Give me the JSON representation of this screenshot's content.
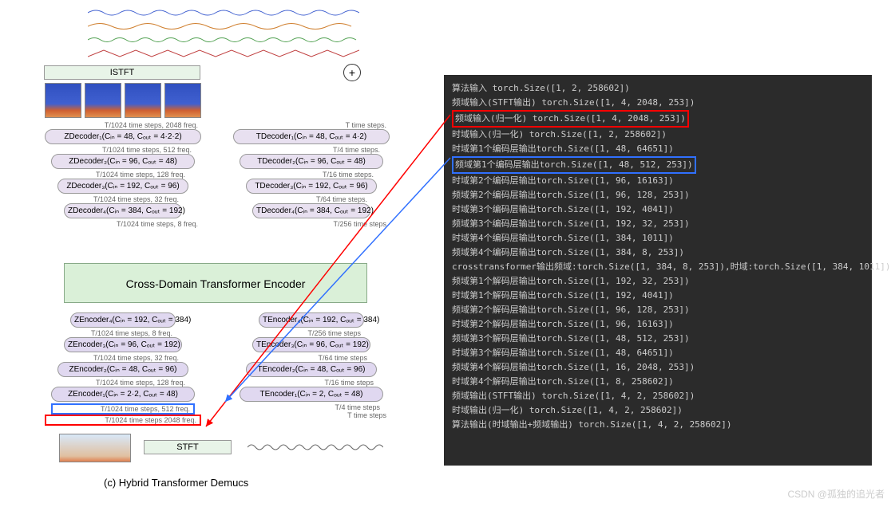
{
  "diagram": {
    "caption": "(c) Hybrid Transformer Demucs",
    "istft": "ISTFT",
    "stft": "STFT",
    "sum": "+",
    "transformer": "Cross-Domain Transformer Encoder",
    "z_decoders": [
      {
        "name": "ZDecoder₁(Cᵢₙ = 48, Cₒᵤₜ = 4·2·2)",
        "lbl": "T/1024 time steps, 2048 freq."
      },
      {
        "name": "ZDecoder₂(Cᵢₙ = 96, Cₒᵤₜ = 48)",
        "lbl": "T/1024 time steps, 512 freq."
      },
      {
        "name": "ZDecoder₃(Cᵢₙ = 192, Cₒᵤₜ = 96)",
        "lbl": "T/1024 time steps, 128 freq."
      },
      {
        "name": "ZDecoder₄(Cᵢₙ = 384, Cₒᵤₜ = 192)",
        "lbl": "T/1024 time steps, 32 freq."
      }
    ],
    "t_decoders": [
      {
        "name": "TDecoder₁(Cᵢₙ = 48, Cₒᵤₜ = 4·2)",
        "lbl": "T time steps."
      },
      {
        "name": "TDecoder₂(Cᵢₙ = 96, Cₒᵤₜ = 48)",
        "lbl": "T/4 time steps."
      },
      {
        "name": "TDecoder₃(Cᵢₙ = 192, Cₒᵤₜ = 96)",
        "lbl": "T/16 time steps."
      },
      {
        "name": "TDecoder₄(Cᵢₙ = 384, Cₒᵤₜ = 192)",
        "lbl": "T/64 time steps."
      }
    ],
    "z_encoders_toplbl": "T/1024 time steps, 8 freq.",
    "t_encoders_toplbl": "T/256 time steps",
    "z_encoders": [
      {
        "name": "ZEncoder₄(Cᵢₙ = 192, Cₒᵤₜ = 384)",
        "lbl": "T/1024 time steps, 8 freq."
      },
      {
        "name": "ZEncoder₃(Cᵢₙ = 96, Cₒᵤₜ = 192)",
        "lbl": "T/1024 time steps, 32 freq."
      },
      {
        "name": "ZEncoder₂(Cᵢₙ = 48, Cₒᵤₜ = 96)",
        "lbl": "T/1024 time steps, 128 freq."
      },
      {
        "name": "ZEncoder₁(Cᵢₙ = 2·2, Cₒᵤₜ = 48)",
        "lbl": "T/1024 time steps, 512 freq.",
        "hl": "blue"
      },
      {
        "lbl": "T/1024 time steps 2048 freq.",
        "hl": "red"
      }
    ],
    "t_encoders": [
      {
        "name": "TEncoder₄(Cᵢₙ = 192, Cₒᵤₜ = 384)",
        "lbl": "T/256 time steps"
      },
      {
        "name": "TEncoder₃(Cᵢₙ = 96, Cₒᵤₜ = 192)",
        "lbl": "T/64 time steps"
      },
      {
        "name": "TEncoder₂(Cᵢₙ = 48, Cₒᵤₜ = 96)",
        "lbl": "T/16 time steps"
      },
      {
        "name": "TEncoder₁(Cᵢₙ = 2, Cₒᵤₜ = 48)",
        "lbl": "T/4 time steps"
      },
      {
        "lbl": "T time steps"
      }
    ]
  },
  "console": {
    "lines": [
      {
        "t": "算法输入 torch.Size([1, 2, 258602])"
      },
      {
        "t": "频域输入(STFT输出) torch.Size([1, 4, 2048, 253])"
      },
      {
        "t": "频域输入(归一化) torch.Size([1, 4, 2048, 253])",
        "hl": "red"
      },
      {
        "t": "时域输入(归一化) torch.Size([1, 2, 258602])"
      },
      {
        "t": "时域第1个编码层输出torch.Size([1, 48, 64651])"
      },
      {
        "t": "频域第1个编码层输出torch.Size([1, 48, 512, 253])",
        "hl": "blue"
      },
      {
        "t": "时域第2个编码层输出torch.Size([1, 96, 16163])"
      },
      {
        "t": "频域第2个编码层输出torch.Size([1, 96, 128, 253])"
      },
      {
        "t": "时域第3个编码层输出torch.Size([1, 192, 4041])"
      },
      {
        "t": "频域第3个编码层输出torch.Size([1, 192, 32, 253])"
      },
      {
        "t": "时域第4个编码层输出torch.Size([1, 384, 1011])"
      },
      {
        "t": "频域第4个编码层输出torch.Size([1, 384, 8, 253])"
      },
      {
        "t": "crosstransformer输出频域:torch.Size([1, 384, 8, 253]),时域:torch.Size([1, 384, 1011])"
      },
      {
        "t": "频域第1个解码层输出torch.Size([1, 192, 32, 253])"
      },
      {
        "t": "时域第1个解码层输出torch.Size([1, 192, 4041])"
      },
      {
        "t": "频域第2个解码层输出torch.Size([1, 96, 128, 253])"
      },
      {
        "t": "时域第2个解码层输出torch.Size([1, 96, 16163])"
      },
      {
        "t": "频域第3个解码层输出torch.Size([1, 48, 512, 253])"
      },
      {
        "t": "时域第3个解码层输出torch.Size([1, 48, 64651])"
      },
      {
        "t": "频域第4个解码层输出torch.Size([1, 16, 2048, 253])"
      },
      {
        "t": "时域第4个解码层输出torch.Size([1, 8, 258602])"
      },
      {
        "t": "频域输出(STFT输出) torch.Size([1, 4, 2, 258602])"
      },
      {
        "t": "时域输出(归一化) torch.Size([1, 4, 2, 258602])"
      },
      {
        "t": "算法输出(时域输出+频域输出) torch.Size([1, 4, 2, 258602])"
      }
    ]
  },
  "watermark": "CSDN @孤独的追光者"
}
